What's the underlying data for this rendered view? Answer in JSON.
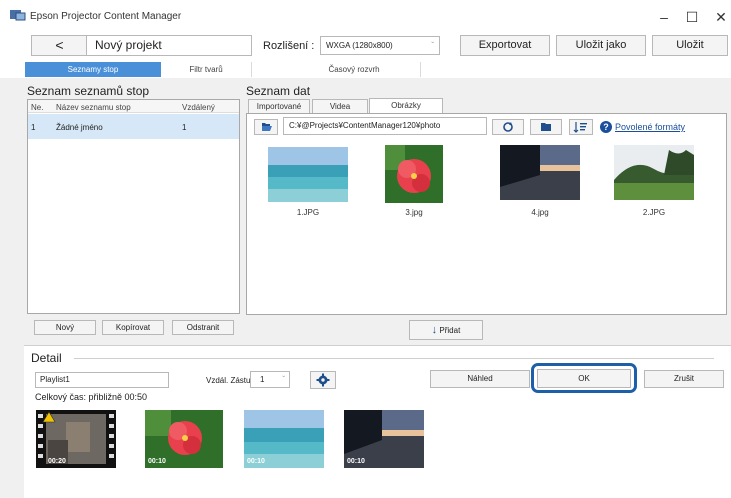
{
  "window": {
    "title": "Epson Projector Content Manager",
    "minimize": "–",
    "maximize": "☐",
    "close": "✕"
  },
  "toolbar": {
    "back": "<",
    "project_name": "Nový projekt",
    "resolution_label": "Rozlišení :",
    "resolution_value": "WXGA (1280x800)",
    "export": "Exportovat",
    "save_as": "Uložit jako",
    "save": "Uložit"
  },
  "tabs": [
    {
      "label": "Seznamy stop",
      "active": true
    },
    {
      "label": "Filtr tvarů",
      "active": false
    },
    {
      "label": "Časový rozvrh",
      "active": false
    }
  ],
  "playlists": {
    "title": "Seznam seznamů stop",
    "columns": [
      "Ne.",
      "Název seznamu stop",
      "Vzdálený"
    ],
    "rows": [
      {
        "no": "1",
        "name": "Žádné jméno",
        "remote": "1"
      }
    ],
    "buttons": {
      "new": "Nový",
      "copy": "Kopírovat",
      "delete": "Odstranit"
    }
  },
  "datalist": {
    "title": "Seznam dat",
    "subtabs": [
      "Importované",
      "Videa",
      "Obrázky"
    ],
    "path": "C:¥@Projects¥ContentManager120¥photo",
    "formats_link": "Povolené formáty",
    "images": [
      {
        "name": "1.JPG",
        "kind": "sea"
      },
      {
        "name": "3.jpg",
        "kind": "flower"
      },
      {
        "name": "4.jpg",
        "kind": "sunset"
      },
      {
        "name": "2.JPG",
        "kind": "trees"
      }
    ],
    "add_button": "Přidat"
  },
  "detail": {
    "title": "Detail",
    "playlist_name": "Playlist1",
    "remote_label": "Vzdál. Zástupce",
    "remote_value": "1",
    "total_time": "Celkový čas: přibližně 00:50",
    "preview": "Náhled",
    "ok": "OK",
    "cancel": "Zrušit",
    "timeline": [
      {
        "kind": "video",
        "duration": "00:20"
      },
      {
        "kind": "flower",
        "duration": "00:10"
      },
      {
        "kind": "sea",
        "duration": "00:10"
      },
      {
        "kind": "sunset",
        "duration": "00:10"
      }
    ]
  },
  "colors": {
    "accent": "#4a90d9",
    "ok_highlight": "#1d5fa8",
    "selection": "#d6e7f7",
    "link": "#1a4f9c"
  }
}
